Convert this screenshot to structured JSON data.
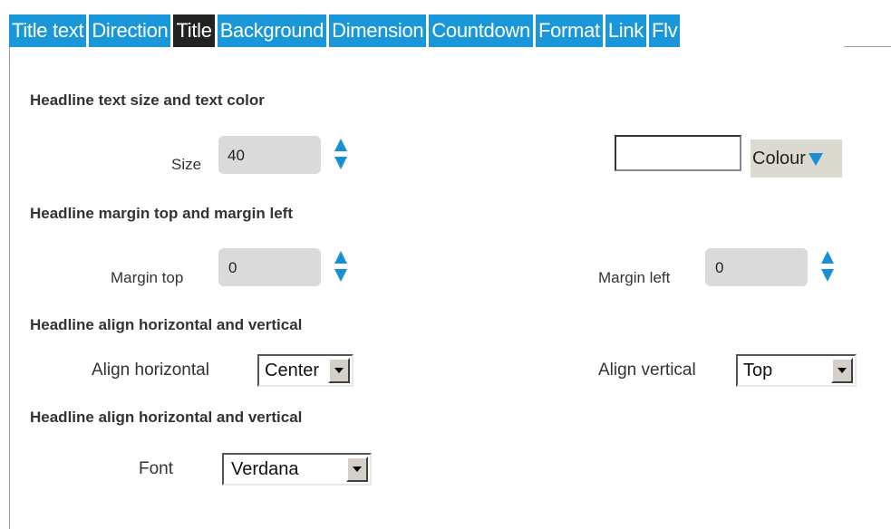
{
  "tabs": [
    {
      "label": "Title text",
      "active": false
    },
    {
      "label": "Direction",
      "active": false
    },
    {
      "label": "Title",
      "active": true
    },
    {
      "label": "Background",
      "active": false
    },
    {
      "label": "Dimension",
      "active": false
    },
    {
      "label": "Countdown",
      "active": false
    },
    {
      "label": "Format",
      "active": false
    },
    {
      "label": "Link",
      "active": false
    },
    {
      "label": "Flv",
      "active": false
    }
  ],
  "sections": {
    "size_color": {
      "heading": "Headline text size and text color",
      "size_label": "Size",
      "size_value": "40",
      "colour_label": "Colour",
      "colour_value": ""
    },
    "margins": {
      "heading": "Headline margin top and margin left",
      "top_label": "Margin top",
      "top_value": "0",
      "left_label": "Margin left",
      "left_value": "0"
    },
    "align": {
      "heading": "Headline align horizontal and vertical",
      "horizontal_label": "Align horizontal",
      "horizontal_value": "Center",
      "vertical_label": "Align vertical",
      "vertical_value": "Top"
    },
    "font": {
      "heading": "Headline align horizontal and vertical",
      "font_label": "Font",
      "font_value": "Verdana"
    }
  },
  "colors": {
    "tab": "#1a97d8",
    "tab_active": "#222222",
    "spinner": "#1a8fd6",
    "input_bg": "#dadada"
  }
}
